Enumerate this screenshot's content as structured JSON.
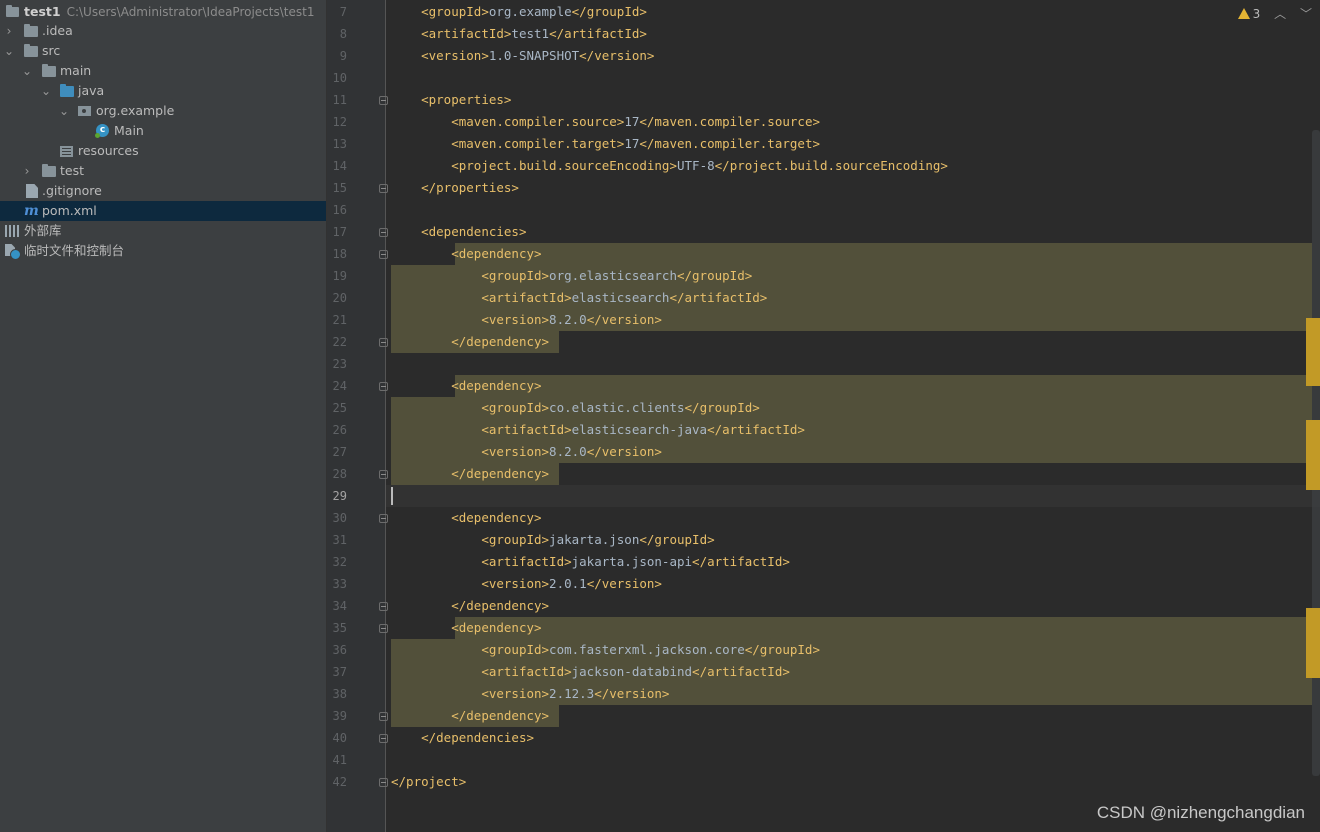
{
  "project_tree": {
    "root_name": "test1",
    "root_path": "C:\\Users\\Administrator\\IdeaProjects\\test1",
    "items": [
      {
        "label": ".idea"
      },
      {
        "label": "src"
      },
      {
        "label": "main"
      },
      {
        "label": "java"
      },
      {
        "label": "org.example"
      },
      {
        "label": "Main"
      },
      {
        "label": "resources"
      },
      {
        "label": "test"
      },
      {
        "label": ".gitignore"
      },
      {
        "label": "pom.xml"
      },
      {
        "label": "外部库"
      },
      {
        "label": "临时文件和控制台"
      }
    ],
    "selected": "pom.xml"
  },
  "editor": {
    "file": "pom.xml",
    "inspection": {
      "warning_count": "3"
    },
    "current_line": 29,
    "lines": [
      {
        "n": 7,
        "indent": 1,
        "tag": "groupId",
        "text": "org.example"
      },
      {
        "n": 8,
        "indent": 1,
        "tag": "artifactId",
        "text": "test1"
      },
      {
        "n": 9,
        "indent": 1,
        "tag": "version",
        "text": "1.0-SNAPSHOT"
      },
      {
        "n": 10,
        "indent": 0,
        "raw": ""
      },
      {
        "n": 11,
        "indent": 1,
        "open": "properties"
      },
      {
        "n": 12,
        "indent": 2,
        "tag": "maven.compiler.source",
        "text": "17"
      },
      {
        "n": 13,
        "indent": 2,
        "tag": "maven.compiler.target",
        "text": "17"
      },
      {
        "n": 14,
        "indent": 2,
        "tag": "project.build.sourceEncoding",
        "text": "UTF-8"
      },
      {
        "n": 15,
        "indent": 1,
        "close": "properties"
      },
      {
        "n": 16,
        "indent": 0,
        "raw": ""
      },
      {
        "n": 17,
        "indent": 1,
        "open": "dependencies"
      },
      {
        "n": 18,
        "indent": 2,
        "open": "dependency"
      },
      {
        "n": 19,
        "indent": 3,
        "tag": "groupId",
        "text": "org.elasticsearch"
      },
      {
        "n": 20,
        "indent": 3,
        "tag": "artifactId",
        "text": "elasticsearch"
      },
      {
        "n": 21,
        "indent": 3,
        "tag": "version",
        "text": "8.2.0"
      },
      {
        "n": 22,
        "indent": 2,
        "close": "dependency"
      },
      {
        "n": 23,
        "indent": 0,
        "raw": ""
      },
      {
        "n": 24,
        "indent": 2,
        "open": "dependency"
      },
      {
        "n": 25,
        "indent": 3,
        "tag": "groupId",
        "text": "co.elastic.clients"
      },
      {
        "n": 26,
        "indent": 3,
        "tag": "artifactId",
        "text": "elasticsearch-java"
      },
      {
        "n": 27,
        "indent": 3,
        "tag": "version",
        "text": "8.2.0"
      },
      {
        "n": 28,
        "indent": 2,
        "close": "dependency"
      },
      {
        "n": 29,
        "indent": 0,
        "raw": ""
      },
      {
        "n": 30,
        "indent": 2,
        "open": "dependency"
      },
      {
        "n": 31,
        "indent": 3,
        "tag": "groupId",
        "text": "jakarta.json"
      },
      {
        "n": 32,
        "indent": 3,
        "tag": "artifactId",
        "text": "jakarta.json-api"
      },
      {
        "n": 33,
        "indent": 3,
        "tag": "version",
        "text": "2.0.1"
      },
      {
        "n": 34,
        "indent": 2,
        "close": "dependency"
      },
      {
        "n": 35,
        "indent": 2,
        "open": "dependency"
      },
      {
        "n": 36,
        "indent": 3,
        "tag": "groupId",
        "text": "com.fasterxml.jackson.core"
      },
      {
        "n": 37,
        "indent": 3,
        "tag": "artifactId",
        "text": "jackson-databind"
      },
      {
        "n": 38,
        "indent": 3,
        "tag": "version",
        "text": "2.12.3"
      },
      {
        "n": 39,
        "indent": 2,
        "close": "dependency"
      },
      {
        "n": 40,
        "indent": 1,
        "close": "dependencies"
      },
      {
        "n": 41,
        "indent": 0,
        "raw": ""
      },
      {
        "n": 42,
        "indent": 0,
        "close": "project"
      }
    ]
  },
  "watermark": "CSDN @nizhengchangdian",
  "colors": {
    "tag": "#e8bf6a",
    "text": "#a9b7c6",
    "highlight": "#52503a",
    "selection": "#0d293e",
    "warning": "#e4b434"
  }
}
